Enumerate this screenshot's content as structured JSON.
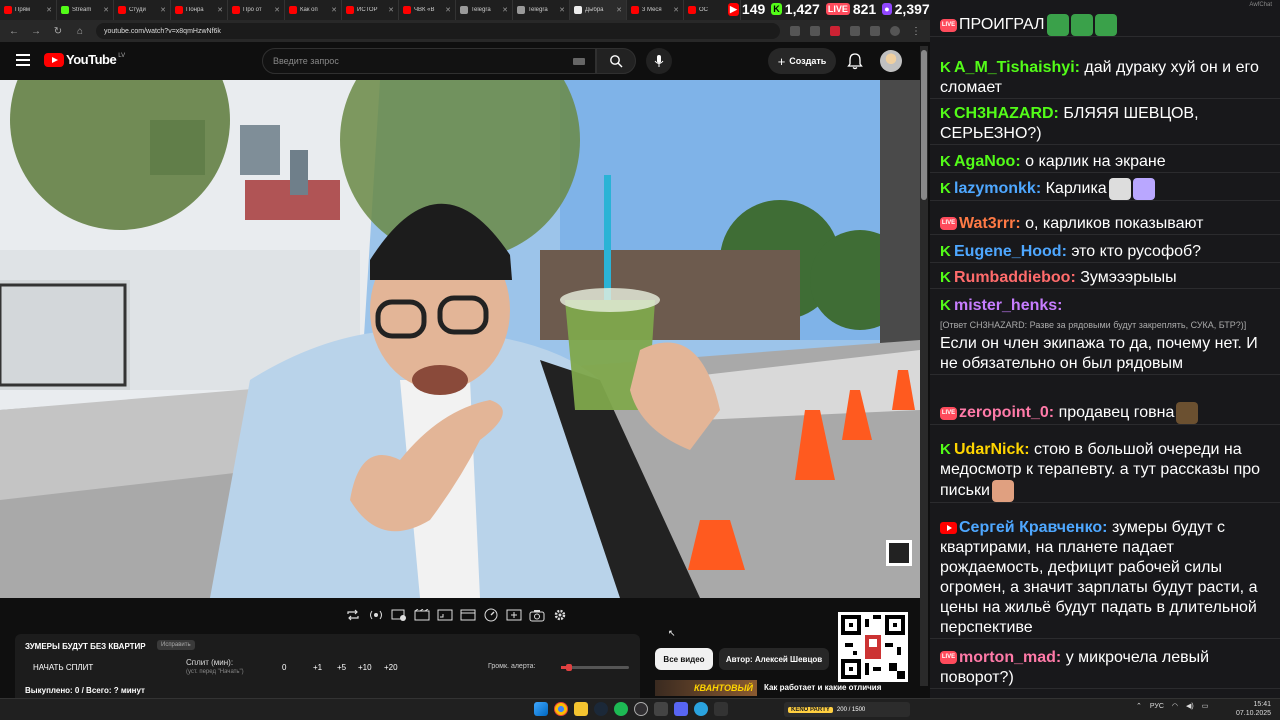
{
  "browser": {
    "tabs": [
      {
        "label": "Прям",
        "color": "#ff0000"
      },
      {
        "label": "Stream",
        "color": "#53fc18"
      },
      {
        "label": "Студи",
        "color": "#ff0000"
      },
      {
        "label": "Понра",
        "color": "#ff0000"
      },
      {
        "label": "Про от",
        "color": "#ff0000"
      },
      {
        "label": "Как оп",
        "color": "#ff0000"
      },
      {
        "label": "ИСТОР",
        "color": "#ff0000"
      },
      {
        "label": "ЧВК «В",
        "color": "#ff0000"
      },
      {
        "label": "Telegra",
        "color": "#999999"
      },
      {
        "label": "Telegra",
        "color": "#999999"
      },
      {
        "label": "Дыбра",
        "color": "#eeeeee"
      },
      {
        "label": "3 Меся",
        "color": "#ff0000"
      },
      {
        "label": "ОС",
        "color": "#ff0000"
      }
    ],
    "url": "youtube.com/watch?v=x8qmHzwNf6k"
  },
  "counters": [
    {
      "icon": "▶",
      "value": "149",
      "color": "#ff0000"
    },
    {
      "icon": "K",
      "value": "1,427",
      "color": "#53fc18"
    },
    {
      "icon": "LIVE",
      "value": "821",
      "color": "#ff4b5c"
    },
    {
      "icon": "●",
      "value": "2,397",
      "color": "#9146ff"
    }
  ],
  "youtube": {
    "logo": "YouTube",
    "country": "LV",
    "search_placeholder": "Введите запрос",
    "create_label": "Создать"
  },
  "split": {
    "title": "ЗУМЕРЫ БУДУТ БЕЗ КВАРТИР",
    "badge": "Исправить",
    "start": "НАЧАТЬ СПЛИТ",
    "label": "Сплит (мин):",
    "sublabel": "(уст. перед \"Начать\")",
    "value": "0",
    "buttons": [
      "+1",
      "+5",
      "+10",
      "+20"
    ],
    "volume_label": "Громк. алерта:",
    "volume": 0.12,
    "footer": "Выкуплено: 0 / Всего: ? минут"
  },
  "below": {
    "chip_all": "Все видео",
    "chip_author": "Автор: Алексей Шевцов",
    "thumb_text": "КВАНТОВЫЙ",
    "next_title": "Как работает и какие отличия"
  },
  "chat": {
    "header": "AwfChat",
    "messages": [
      {
        "badge": "live",
        "nick": "",
        "nick_color": "#ff6b6b",
        "text": "ПРОИГРАЛ",
        "reply": "",
        "emotes": [
          "#3aa14a",
          "#3aa14a",
          "#3aa14a"
        ]
      },
      {
        "badge": "kick",
        "nick": "A_M_Tishaishyi:",
        "nick_color": "#53fc18",
        "text": "дай дураку хуй он и его сломает",
        "reply": "",
        "emotes": []
      },
      {
        "badge": "kick",
        "nick": "CH3HAZARD:",
        "nick_color": "#53fc18",
        "text": "БЛЯЯЯ ШЕВЦОВ, СЕРЬЕЗНО?)",
        "reply": "",
        "emotes": []
      },
      {
        "badge": "kick",
        "nick": "AgaNoo:",
        "nick_color": "#53fc18",
        "text": "о карлик на экране",
        "reply": "",
        "emotes": []
      },
      {
        "badge": "kick",
        "nick": "lazymonkk:",
        "nick_color": "#4ea7ff",
        "text": "Карлика",
        "reply": "",
        "emotes": [
          "#dddddd",
          "#b9a7ff"
        ]
      },
      {
        "badge": "live",
        "nick": "Wat3rrr:",
        "nick_color": "#ff7a45",
        "text": "о, карликов показывают",
        "reply": "",
        "emotes": []
      },
      {
        "badge": "kick",
        "nick": "Eugene_Hood:",
        "nick_color": "#4ea7ff",
        "text": "это кто русофоб?",
        "reply": "",
        "emotes": []
      },
      {
        "badge": "kick",
        "nick": "Rumbaddieboo:",
        "nick_color": "#ff6b6b",
        "text": "Зумэээрыыы",
        "reply": "",
        "emotes": []
      },
      {
        "badge": "kick",
        "nick": "mister_henks:",
        "nick_color": "#c77dff",
        "text": "Если он член экипажа то да, почему нет. И не обязательно он был рядовым",
        "reply": "[Ответ CH3HAZARD: Разве за рядовыми будут закреплять, СУКА, БТР?)]",
        "emotes": []
      },
      {
        "badge": "live",
        "nick": "zeropoint_0:",
        "nick_color": "#ff7aa8",
        "text": "продавец говна",
        "reply": "",
        "emotes": [
          "#6b5030"
        ]
      },
      {
        "badge": "kick",
        "nick": "UdarNick:",
        "nick_color": "#ffd500",
        "text": "стою в большой очереди на медосмотр к терапевту. а тут рассказы про письки",
        "reply": "",
        "emotes": [
          "#e0a080"
        ]
      },
      {
        "badge": "yt",
        "nick": "Сергей Кравченко:",
        "nick_color": "#4ea7ff",
        "text": "зумеры будут с квартирами, на планете падает рождаемость, дефицит рабочей силы огромен, а значит зарплаты будут расти, а цены на жильё будут падать в длительной перспективе",
        "reply": "",
        "emotes": []
      },
      {
        "badge": "live",
        "nick": "morton_mad:",
        "nick_color": "#ff7aa8",
        "text": "у микрочела левый поворот?)",
        "reply": "",
        "emotes": []
      }
    ]
  },
  "taskbar": {
    "media_text": "200 / 1500",
    "media_label": "KENO PARTY",
    "lang": "РУС",
    "time": "15:41",
    "date": "07.10.2025"
  }
}
